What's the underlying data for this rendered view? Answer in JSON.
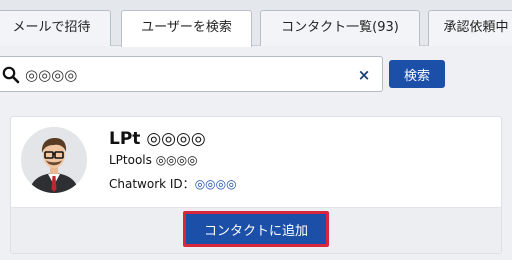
{
  "tabs": [
    {
      "label": "メールで招待"
    },
    {
      "label": "ユーザーを検索"
    },
    {
      "label": "コンタクト一覧(93)"
    },
    {
      "label": "承認依頼中"
    }
  ],
  "search": {
    "value": "◎◎◎◎",
    "clear_glyph": "×",
    "button_label": "検索",
    "icon": "search-icon"
  },
  "result": {
    "name": "LPt ◎◎◎◎",
    "org": "LPtools ◎◎◎◎",
    "chatwork_id_label": "Chatwork ID：",
    "chatwork_id_value": "◎◎◎◎",
    "add_button_label": "コンタクトに追加"
  },
  "colors": {
    "accent": "#1c4fa8",
    "highlight": "#d8263a",
    "background": "#eef0f4"
  }
}
